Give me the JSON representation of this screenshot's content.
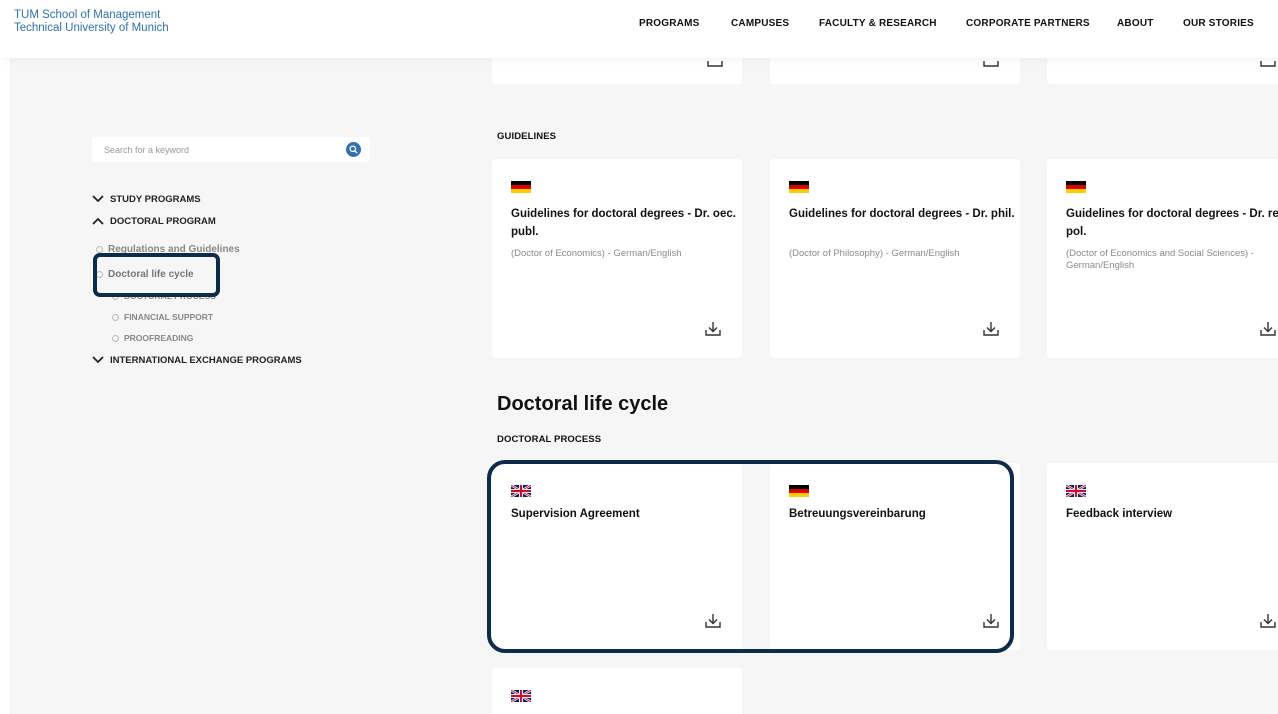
{
  "header": {
    "logo_line1": "TUM School of Management",
    "logo_line2": "Technical University of Munich",
    "nav": [
      "PROGRAMS",
      "CAMPUSES",
      "FACULTY & RESEARCH",
      "CORPORATE PARTNERS",
      "ABOUT",
      "OUR STORIES"
    ]
  },
  "sidebar": {
    "search_placeholder": "Search for a keyword",
    "search_icon": "search-icon",
    "items": [
      {
        "label": "STUDY PROGRAMS",
        "icon": "chevron-down-icon"
      },
      {
        "label": "DOCTORAL PROGRAM",
        "icon": "chevron-up-icon"
      },
      {
        "label": "Regulations and Guidelines"
      },
      {
        "label": "Doctoral life cycle"
      },
      {
        "label": "DOCTORAL PROCESS"
      },
      {
        "label": "FINANCIAL SUPPORT"
      },
      {
        "label": "PROOFREADING"
      },
      {
        "label": "INTERNATIONAL EXCHANGE PROGRAMS",
        "icon": "chevron-down-icon"
      }
    ]
  },
  "content": {
    "guidelines_label": "GUIDELINES",
    "guidelines_cards": [
      {
        "flag": "de-flag-icon",
        "title": "Guidelines for doctoral degrees - Dr. oec. publ.",
        "desc": "(Doctor of Economics) - German/English"
      },
      {
        "flag": "de-flag-icon",
        "title": "Guidelines for doctoral degrees - Dr. phil.",
        "desc": "(Doctor of Philosophy) - German/English"
      },
      {
        "flag": "de-flag-icon",
        "title": "Guidelines for doctoral degrees - Dr. rer. pol.",
        "desc": "(Doctor of Economics and Social Sciences) - German/English"
      }
    ],
    "life_cycle_title": "Doctoral life cycle",
    "process_label": "DOCTORAL PROCESS",
    "process_cards": [
      {
        "flag": "uk-flag-icon",
        "title": "Supervision Agreement"
      },
      {
        "flag": "de-flag-icon",
        "title": "Betreuungsvereinbarung"
      },
      {
        "flag": "uk-flag-icon",
        "title": "Feedback interview"
      }
    ]
  },
  "colors": {
    "brand_blue": "#3070b3",
    "highlight_navy": "#0e2b49",
    "background_gray": "#f6f6f6"
  }
}
